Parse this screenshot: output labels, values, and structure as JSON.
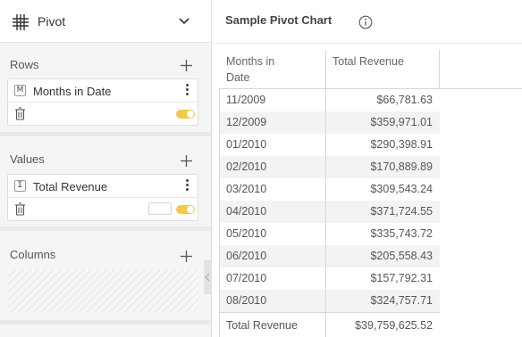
{
  "panel": {
    "title": "Pivot",
    "sections": {
      "rows": {
        "label": "Rows",
        "field": {
          "badge": "M",
          "name": "Months in Date"
        }
      },
      "values": {
        "label": "Values",
        "field": {
          "badge": "Σ",
          "name": "Total Revenue"
        }
      },
      "columns": {
        "label": "Columns"
      }
    },
    "colors": {
      "toggle": "#f2c94c",
      "background": "#f5f5f5"
    }
  },
  "chart": {
    "title": "Sample Pivot Chart",
    "table": {
      "headers": [
        "Months in Date",
        "Total Revenue"
      ],
      "rows": [
        [
          "11/2009",
          "$66,781.63"
        ],
        [
          "12/2009",
          "$359,971.01"
        ],
        [
          "01/2010",
          "$290,398.91"
        ],
        [
          "02/2010",
          "$170,889.89"
        ],
        [
          "03/2010",
          "$309,543.24"
        ],
        [
          "04/2010",
          "$371,724.55"
        ],
        [
          "05/2010",
          "$335,743.72"
        ],
        [
          "06/2010",
          "$205,558.43"
        ],
        [
          "07/2010",
          "$157,792.31"
        ],
        [
          "08/2010",
          "$324,757.71"
        ]
      ],
      "total": {
        "label": "Total Revenue",
        "value": "$39,759,625.52"
      }
    }
  }
}
